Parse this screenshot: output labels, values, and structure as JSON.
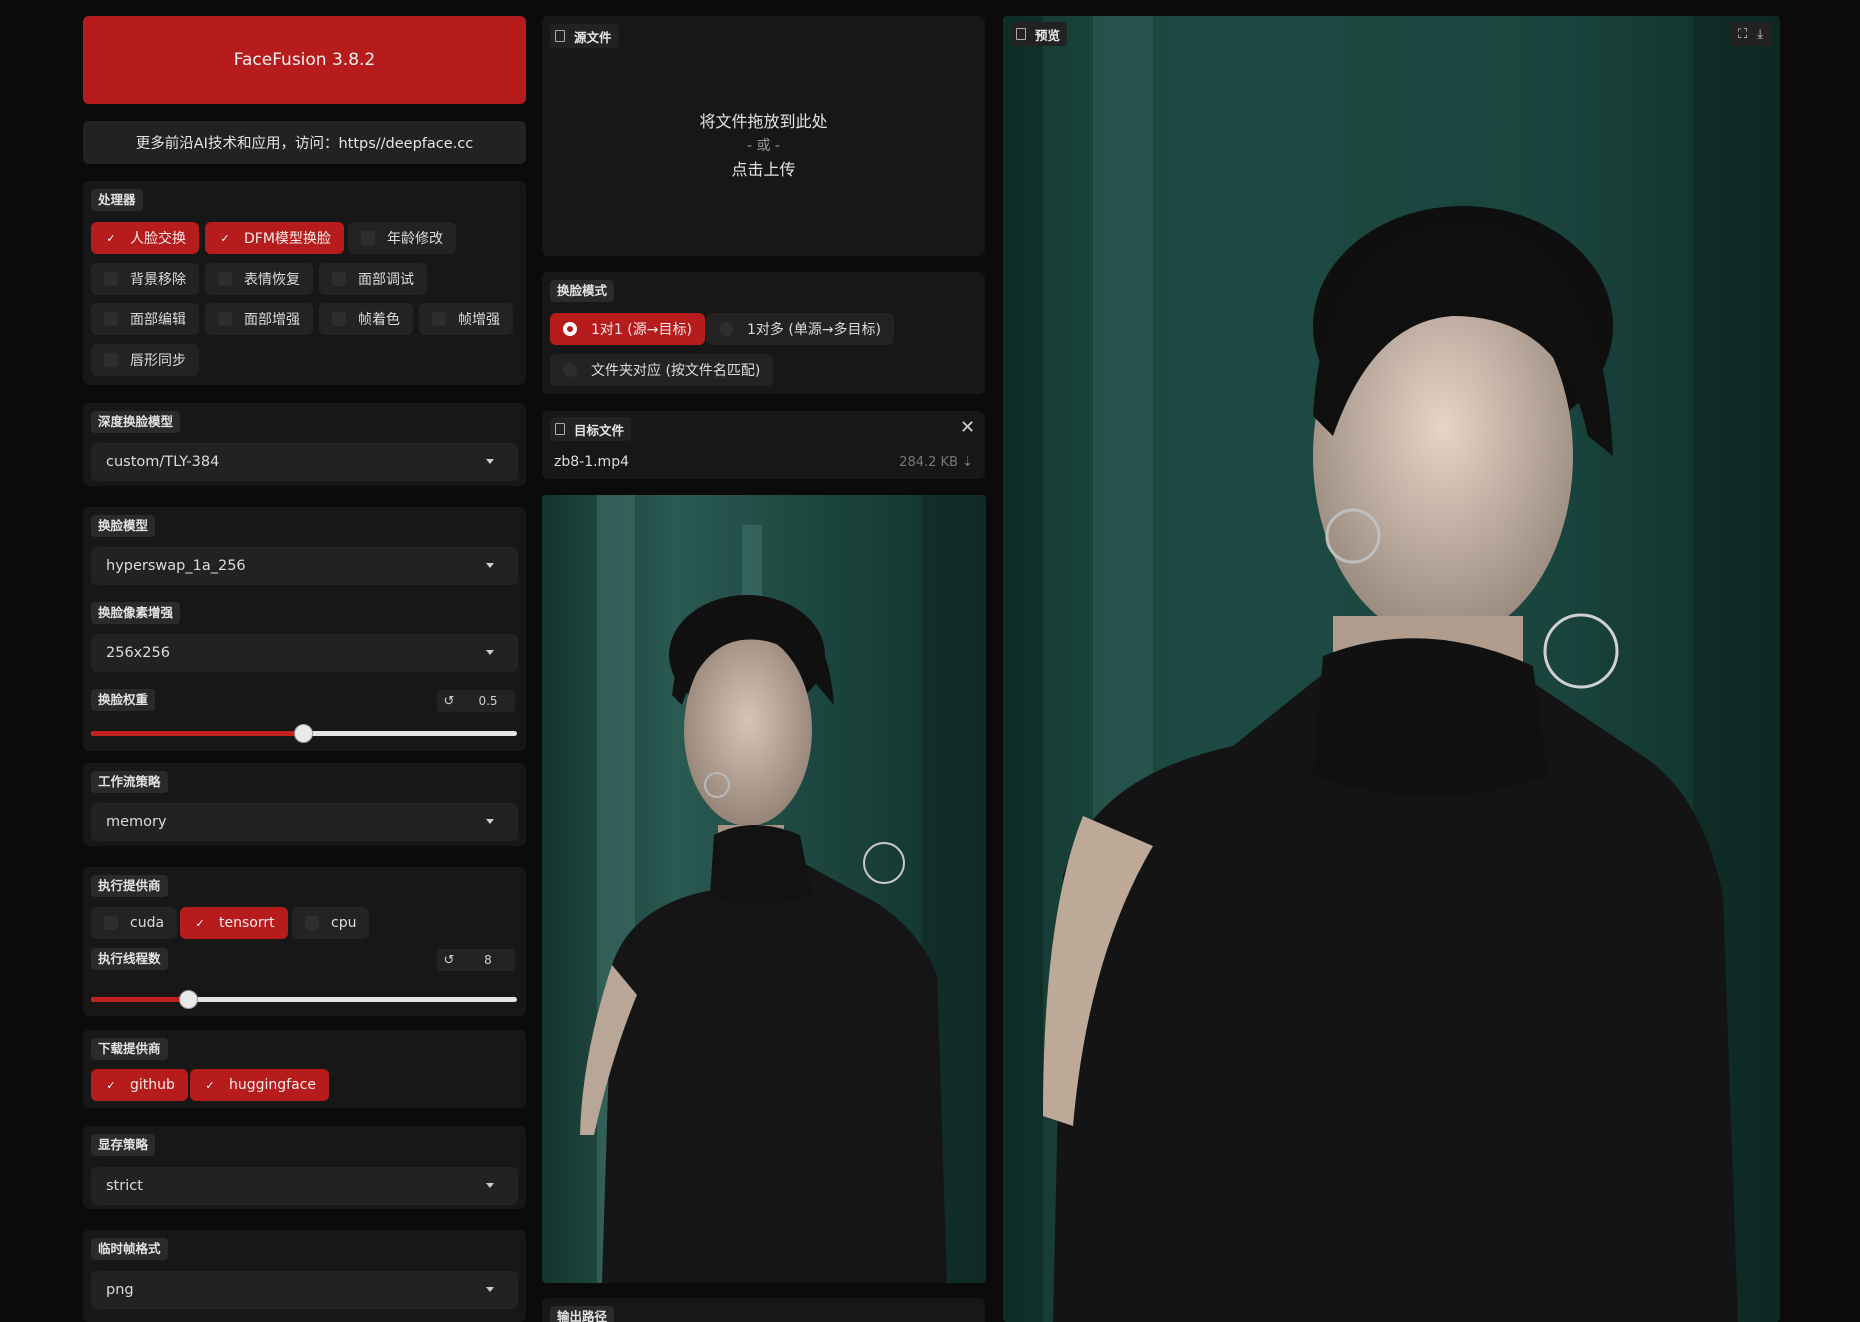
{
  "header": {
    "title": "FaceFusion 3.8.2",
    "info": "更多前沿AI技术和应用，访问：https//deepface.cc"
  },
  "processors": {
    "label": "处理器",
    "items": [
      {
        "label": "人脸交换",
        "checked": true
      },
      {
        "label": "DFM模型换脸",
        "checked": true
      },
      {
        "label": "年龄修改",
        "checked": false
      },
      {
        "label": "背景移除",
        "checked": false
      },
      {
        "label": "表情恢复",
        "checked": false
      },
      {
        "label": "面部调试",
        "checked": false
      },
      {
        "label": "面部编辑",
        "checked": false
      },
      {
        "label": "面部增强",
        "checked": false
      },
      {
        "label": "帧着色",
        "checked": false
      },
      {
        "label": "帧增强",
        "checked": false
      },
      {
        "label": "唇形同步",
        "checked": false
      }
    ]
  },
  "deep_swapper": {
    "label": "深度换脸模型",
    "value": "custom/TLY-384"
  },
  "face_swapper": {
    "model_label": "换脸模型",
    "model_value": "hyperswap_1a_256",
    "pixel_boost_label": "换脸像素增强",
    "pixel_boost_value": "256x256",
    "weight_label": "换脸权重",
    "weight_value": "0.5",
    "weight_fraction": 0.5
  },
  "workflow": {
    "label": "工作流策略",
    "value": "memory"
  },
  "execution": {
    "providers_label": "执行提供商",
    "providers": [
      {
        "label": "cuda",
        "checked": false
      },
      {
        "label": "tensorrt",
        "checked": true
      },
      {
        "label": "cpu",
        "checked": false
      }
    ],
    "threads_label": "执行线程数",
    "threads_value": "8",
    "threads_fraction": 0.23
  },
  "download": {
    "label": "下载提供商",
    "providers": [
      {
        "label": "github",
        "checked": true
      },
      {
        "label": "huggingface",
        "checked": true
      }
    ]
  },
  "memory": {
    "label": "显存策略",
    "value": "strict"
  },
  "temp_frame": {
    "label": "临时帧格式",
    "value": "png"
  },
  "source": {
    "label": "源文件",
    "drop_line1": "将文件拖放到此处",
    "drop_line2": "- 或 -",
    "drop_line3": "点击上传"
  },
  "swap_mode": {
    "label": "换脸模式",
    "options": [
      {
        "label": "1对1 (源→目标)",
        "selected": true
      },
      {
        "label": "1对多 (单源→多目标)",
        "selected": false
      },
      {
        "label": "文件夹对应 (按文件名匹配)",
        "selected": false
      }
    ]
  },
  "target": {
    "label": "目标文件",
    "file_name": "zb8-1.mp4",
    "file_size": "284.2 KB ⇣"
  },
  "output": {
    "label": "输出路径"
  },
  "preview": {
    "label": "预览"
  },
  "colors": {
    "accent": "#b61c1c",
    "panel": "#171717",
    "background": "#0b0b0b"
  }
}
